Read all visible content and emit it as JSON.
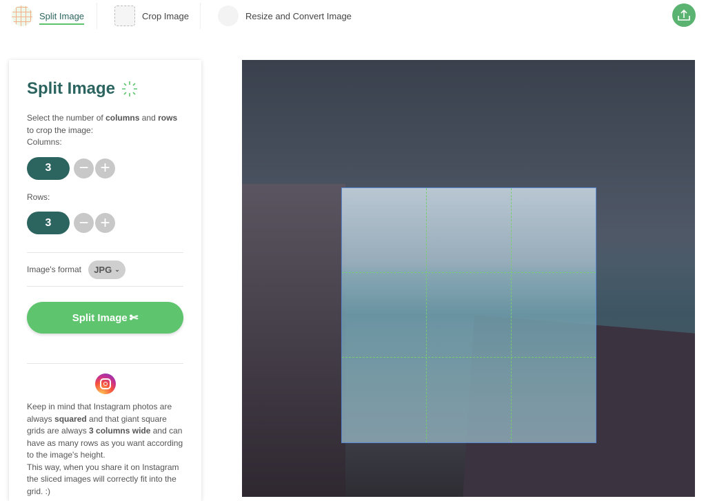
{
  "nav": {
    "tabs": [
      {
        "label": "Split Image",
        "icon": "grid-split-icon",
        "active": true
      },
      {
        "label": "Crop Image",
        "icon": "crop-icon"
      },
      {
        "label": "Resize and Convert Image",
        "icon": "resize-icon"
      }
    ],
    "upload_icon": "upload-cloud-icon"
  },
  "panel": {
    "title": "Split Image",
    "intro_1": "Select the number of ",
    "intro_b1": "columns",
    "intro_2": " and ",
    "intro_b2": "rows",
    "intro_3": " to crop the image:",
    "columns_label": "Columns:",
    "columns": "3",
    "rows_label": "Rows:",
    "rows": "3",
    "format_label": "Image's format",
    "format": "JPG",
    "split_button": "Split Image",
    "note_1": "Keep in mind that Instagram photos are always ",
    "note_b1": "squared",
    "note_2": " and that giant square grids are always ",
    "note_b2": "3 columns wide",
    "note_3": " and can have as many rows as you want according to the image's height.",
    "note_4": "This way, when you share it on Instagram the sliced images will correctly fit into the grid. :)"
  },
  "colors": {
    "accent": "#2c6460",
    "button": "#5ec46e",
    "grid": "#7ddc6f",
    "crop_border": "#5b8fe0"
  }
}
